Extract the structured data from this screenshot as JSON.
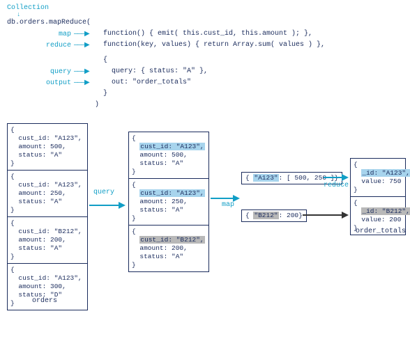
{
  "header": {
    "collection_label": "Collection",
    "invoke": "db.orders.mapReduce(",
    "labels": {
      "map": "map",
      "reduce": "reduce",
      "query": "query",
      "output": "output"
    },
    "code": {
      "map_fn": "function() { emit( this.cust_id, this.amount ); },",
      "reduce_fn": "function(key, values) { return Array.sum( values ) },",
      "opts_open": "{",
      "query_line": "  query: { status: \"A\" },",
      "out_line": "  out: \"order_totals\"",
      "opts_close": "}",
      "close": ")"
    }
  },
  "flow_labels": {
    "query": "query",
    "map": "map",
    "reduce": "reduce"
  },
  "captions": {
    "orders": "orders",
    "order_totals": "order_totals"
  },
  "orders_docs": [
    {
      "open": "{",
      "l1": "  cust_id: \"A123\",",
      "l2": "  amount: 500,",
      "l3": "  status: \"A\"",
      "close": "}"
    },
    {
      "open": "{",
      "l1": "  cust_id: \"A123\",",
      "l2": "  amount: 250,",
      "l3": "  status: \"A\"",
      "close": "}"
    },
    {
      "open": "{",
      "l1": "  cust_id: \"B212\",",
      "l2": "  amount: 200,",
      "l3": "  status: \"A\"",
      "close": "}"
    },
    {
      "open": "{",
      "l1": "  cust_id: \"A123\",",
      "l2": "  amount: 300,",
      "l3": "  status: \"D\"",
      "close": "}"
    }
  ],
  "filtered_docs": [
    {
      "open": "{",
      "k": "cust_id: \"A123\",",
      "l2": "  amount: 500,",
      "l3": "  status: \"A\"",
      "close": "}",
      "hl": "hl-blue"
    },
    {
      "open": "{",
      "k": "cust_id: \"A123\",",
      "l2": "  amount: 250,",
      "l3": "  status: \"A\"",
      "close": "}",
      "hl": "hl-blue"
    },
    {
      "open": "{",
      "k": "cust_id: \"B212\",",
      "l2": "  amount: 200,",
      "l3": "  status: \"A\"",
      "close": "}",
      "hl": "hl-gray"
    }
  ],
  "mapped": [
    {
      "b_open": "{ ",
      "key": "\"A123\"",
      "val": ": [ 500, 250 ]",
      "b_close": "}",
      "hl": "hl-blue"
    },
    {
      "b_open": "{ ",
      "key": "\"B212\"",
      "val": ": 200",
      "b_close": "}",
      "hl": "hl-gray"
    }
  ],
  "results": [
    {
      "open": "{",
      "k": "_id: \"A123\",",
      "v": "  value: 750",
      "close": "}",
      "hl": "hl-blue"
    },
    {
      "open": "{",
      "k": "_id: \"B212\",",
      "v": "  value: 200",
      "close": "}",
      "hl": "hl-gray"
    }
  ]
}
